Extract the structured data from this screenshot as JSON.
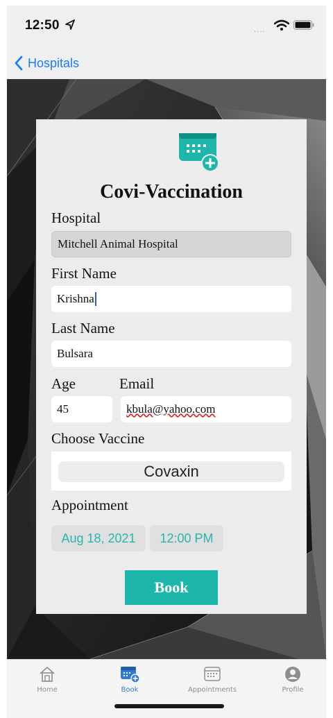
{
  "status_bar": {
    "time": "12:50"
  },
  "nav": {
    "back_label": "Hospitals"
  },
  "form": {
    "title": "Covi-Vaccination",
    "hospital_label": "Hospital",
    "hospital_value": "Mitchell Animal Hospital",
    "first_name_label": "First Name",
    "first_name_value": "Krishna",
    "last_name_label": "Last Name",
    "last_name_value": "Bulsara",
    "age_label": "Age",
    "age_value": "45",
    "email_label": "Email",
    "email_value": "kbula@yahoo.com",
    "vaccine_label": "Choose Vaccine",
    "vaccine_selected": "Covaxin",
    "appointment_label": "Appointment",
    "appointment_date": "Aug 18, 2021",
    "appointment_time": "12:00 PM",
    "book_label": "Book"
  },
  "tabs": [
    {
      "label": "Home",
      "icon": "home-icon",
      "active": false
    },
    {
      "label": "Book",
      "icon": "calendar-add-icon",
      "active": true
    },
    {
      "label": "Appointments",
      "icon": "calendar-icon",
      "active": false
    },
    {
      "label": "Profile",
      "icon": "person-icon",
      "active": false
    }
  ],
  "colors": {
    "accent": "#1cb6ab",
    "link_blue": "#1d7bf6",
    "active_tab": "#2f7bd3"
  }
}
